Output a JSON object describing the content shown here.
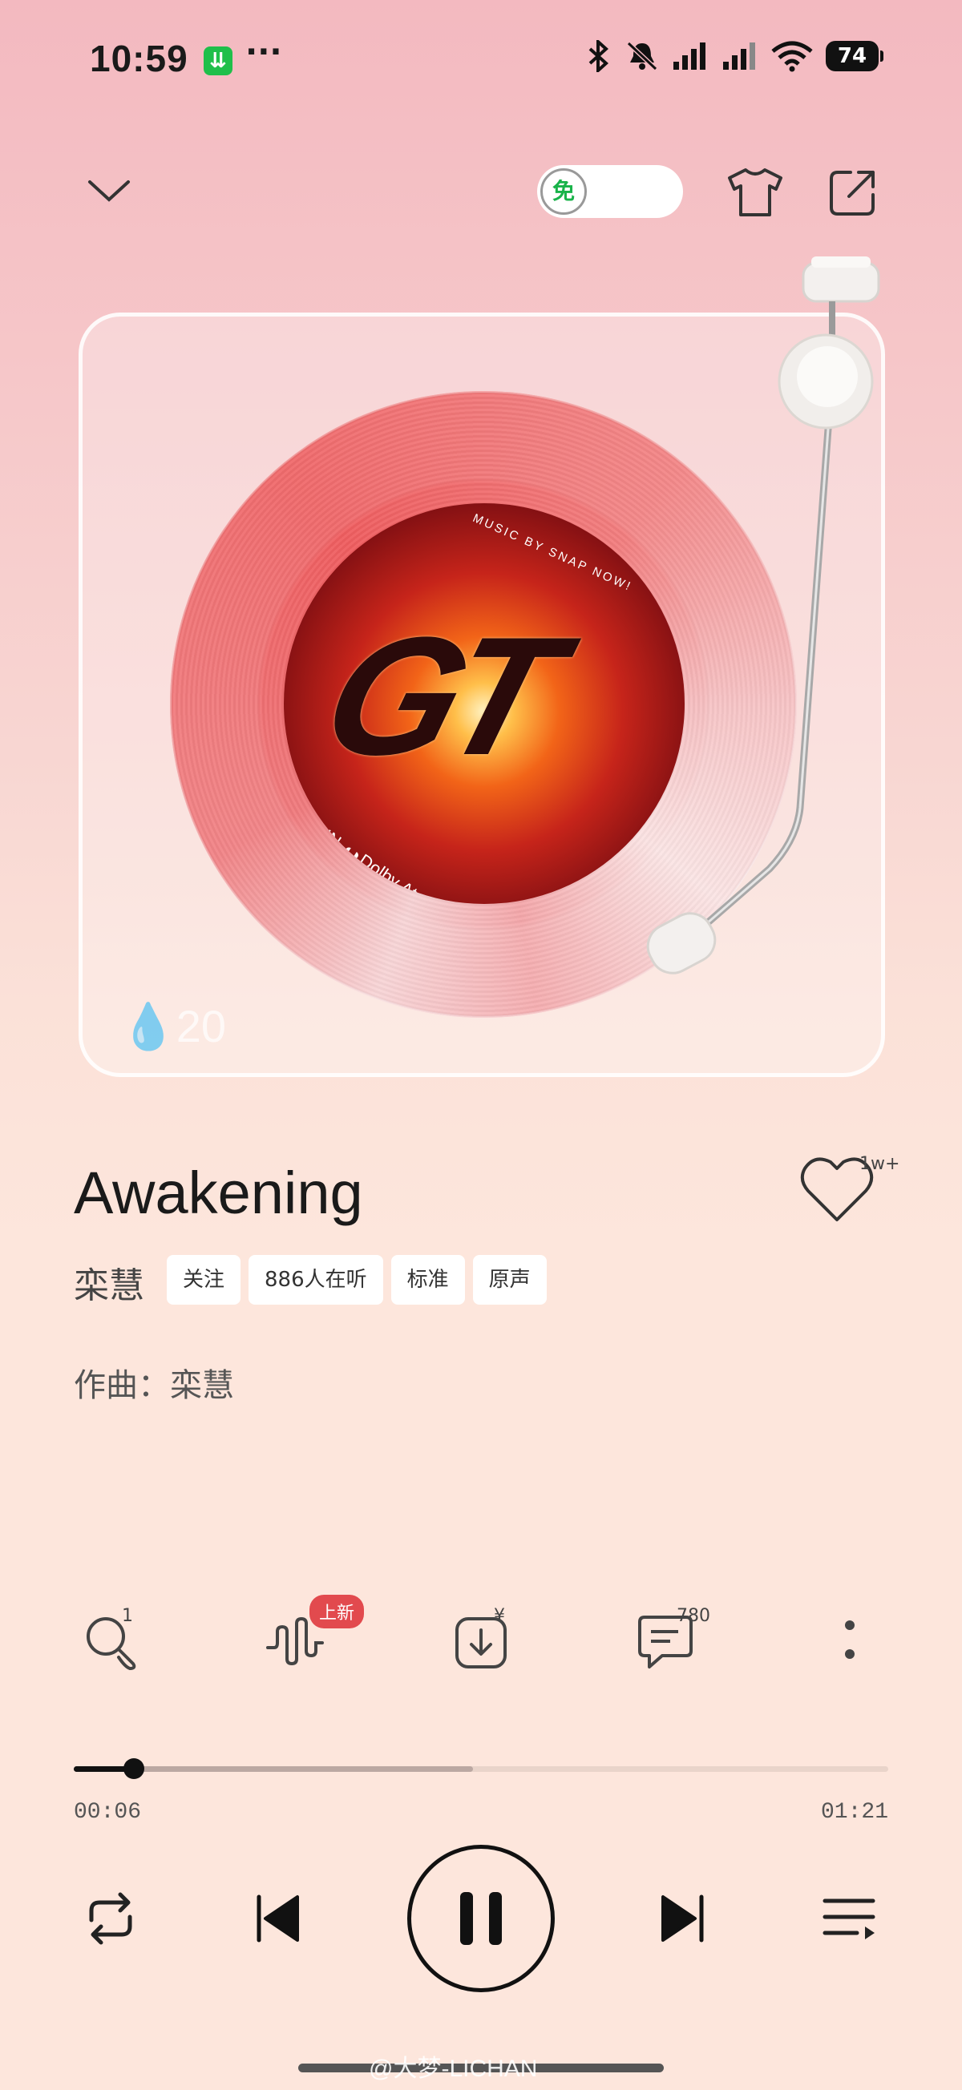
{
  "status_bar": {
    "time": "10:59",
    "app_badge": "⇊",
    "more": "···",
    "battery": "74"
  },
  "header": {
    "free_label": "免"
  },
  "record": {
    "label_top_text": "MUSIC BY  SNAP NOW!",
    "label_title": "GT",
    "label_bottom_text": "IN ◖◗Dolby Atmos",
    "watermark": "20"
  },
  "song": {
    "title": "Awakening",
    "artist": "栾慧",
    "like_count": "1w+",
    "tags": [
      "关注",
      "886人在听",
      "标准",
      "原声"
    ],
    "composer": "作曲：栾慧"
  },
  "actions": {
    "search_count": "1",
    "sound_badge": "上新",
    "download_badge": "¥",
    "comment_count": "780"
  },
  "progress": {
    "current": "00:06",
    "total": "01:21",
    "played_fraction": 0.074,
    "buffered_fraction": 0.49
  },
  "watermark": "@大梦-LICHAN",
  "colors": {
    "accent_green": "#1fbf4a",
    "badge_red": "#e24a4e"
  }
}
